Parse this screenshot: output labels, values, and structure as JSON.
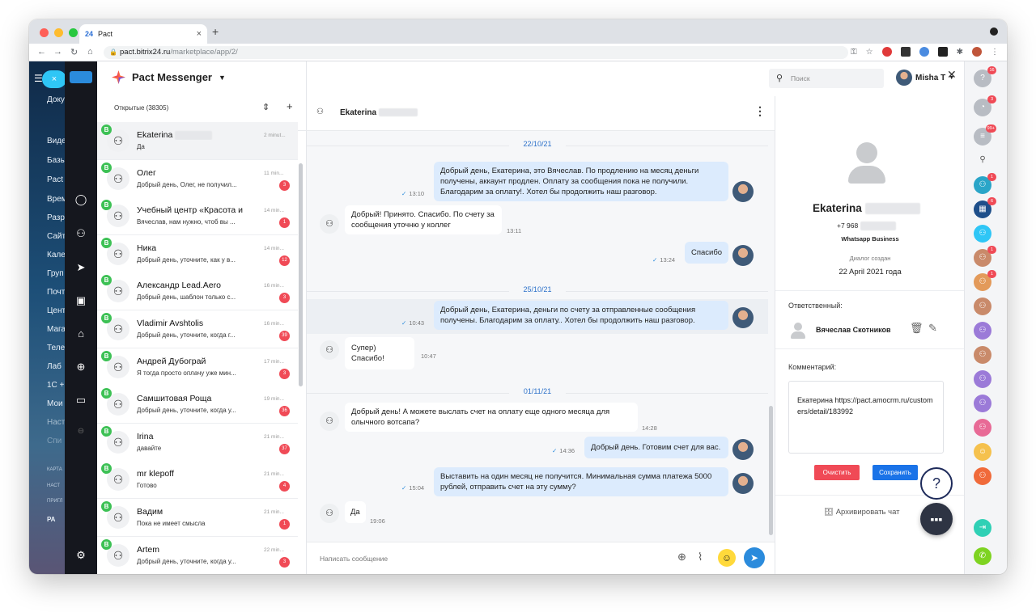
{
  "browser": {
    "tab_title": "Pact",
    "tab_favicon": "24",
    "tab_close": "×",
    "new_tab": "+",
    "url_host": "pact.bitrix24.ru",
    "url_path": "/marketplace/app/2/"
  },
  "app": {
    "name": "Pact Messenger",
    "search_placeholder": "Поиск",
    "user_name": "Misha T"
  },
  "bitrix_sidebar": {
    "items": [
      "Доку",
      "Виде",
      "Базы",
      "Pact",
      "Врем",
      "Разр",
      "Сайт",
      "Кале",
      "Груп",
      "Почт",
      "Цент",
      "Мага",
      "Теле",
      "Лаб",
      "1С +",
      "Мои",
      "Наст",
      "Спи"
    ],
    "small": [
      "КАРТА",
      "НАСТ",
      "ПРИГЛ"
    ],
    "footer": "РА"
  },
  "chat_list": {
    "filter_label": "Открытые (38305)",
    "items": [
      {
        "name": "Ekaterina",
        "preview": "Да",
        "time": "2 minut...",
        "badge": ""
      },
      {
        "name": "Олег",
        "preview": "Добрый день, Олег, не получил...",
        "time": "11 min...",
        "badge": "3"
      },
      {
        "name": "Учебный центр «Красота и",
        "preview": "Вячеслав, нам нужно, чтоб вы ...",
        "time": "14 min...",
        "badge": "1"
      },
      {
        "name": "Ника",
        "preview": "Добрый день, уточните, как у в...",
        "time": "14 min...",
        "badge": "12"
      },
      {
        "name": "Александр Lead.Aero",
        "preview": "Добрый день, шаблон только с...",
        "time": "16 min...",
        "badge": "3"
      },
      {
        "name": "Vladimir Avshtolis",
        "preview": "Добрый день, уточните, когда г...",
        "time": "16 min...",
        "badge": "39"
      },
      {
        "name": "Андрей Дубограй",
        "preview": "Я тогда просто оплачу уже мин...",
        "time": "17 min...",
        "badge": "3"
      },
      {
        "name": "Самшитовая Роща",
        "preview": "Добрый день, уточните, когда у...",
        "time": "19 min...",
        "badge": "36"
      },
      {
        "name": "Irina",
        "preview": "давайте",
        "time": "21 min...",
        "badge": "37"
      },
      {
        "name": "mr klepoff",
        "preview": "Готово",
        "time": "21 min...",
        "badge": "4"
      },
      {
        "name": "Вадим",
        "preview": "Пока не имеет смысла",
        "time": "21 min...",
        "badge": "1"
      },
      {
        "name": "Artem",
        "preview": "Добрый день, уточните, когда у...",
        "time": "22 min...",
        "badge": "3"
      }
    ]
  },
  "chat": {
    "contact_name": "Ekaterina",
    "dates": [
      "22/10/21",
      "25/10/21",
      "01/11/21"
    ],
    "messages": [
      {
        "dir": "out",
        "text": "Добрый день, Екатерина, это Вячеслав. По продлению на месяц деньги получены, аккаунт продлен. Оплату за сообщения пока не получили. Благодарим за оплату!. Хотел бы продолжить наш разговор.",
        "time": "13:10"
      },
      {
        "dir": "in",
        "text": "Добрый! Принято. Спасибо. По счету за сообщения уточню у коллег",
        "time": "13:11"
      },
      {
        "dir": "out",
        "text": "Спасибо",
        "time": "13:24"
      },
      {
        "dir": "out",
        "text": "Добрый день, Екатерина, деньги по счету за отправленные сообщения получены. Благодарим за оплату.. Хотел бы продолжить наш разговор.",
        "time": "10:43"
      },
      {
        "dir": "in",
        "text": "Супер) Спасибо!",
        "time": "10:47"
      },
      {
        "dir": "in",
        "text": "Добрый день! А можете выслать счет на оплату еще одного месяца для олычного вотсапа?",
        "time": "14:28"
      },
      {
        "dir": "out",
        "text": "Добрый день. Готовим счет для вас.",
        "time": "14:36"
      },
      {
        "dir": "out",
        "text": "Выставить на один месяц не получится. Минимальная сумма платежа 5000 рублей, отправить счет на эту сумму?",
        "time": "15:04"
      },
      {
        "dir": "in",
        "text": "Да",
        "time": "19:06"
      }
    ],
    "composer_placeholder": "Написать сообщение"
  },
  "contact_info": {
    "name": "Ekaterina",
    "phone": "+7 968",
    "channel": "Whatsapp Business",
    "created_label": "Диалог создан",
    "created_date": "22 April 2021 года",
    "responsible_label": "Ответственный:",
    "responsible_name": "Вячеслав Скотников",
    "comment_label": "Комментарий:",
    "comment_text": "Екатерина https://pact.amocrm.ru/customers/detail/183992",
    "clear_button": "Очистить",
    "save_button": "Сохранить",
    "archive_label": "Архивировать чат"
  },
  "right_rail": {
    "badges": [
      "16",
      "3",
      "99+",
      "1",
      "6",
      "1",
      "1",
      "1"
    ]
  },
  "colors": {
    "accent": "#2b8bdc",
    "whatsapp": "#3dc155",
    "badge": "#f04a56",
    "outgoing_bubble": "#dcebfd",
    "clear": "#f04a56",
    "save": "#1a73e8"
  }
}
